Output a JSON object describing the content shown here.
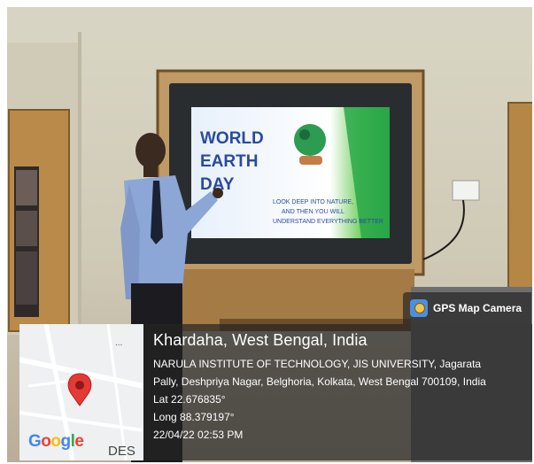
{
  "screen": {
    "title": "WORLD EARTH DAY",
    "tagline_1": "LOOK DEEP INTO NATURE,",
    "tagline_2": "AND THEN YOU WILL",
    "tagline_3": "UNDERSTAND EVERYTHING BETTER"
  },
  "badge": {
    "app_name": "GPS Map Camera",
    "icon": "gps-map-camera-icon"
  },
  "location": {
    "title": "Khardaha, West Bengal, India",
    "address_line_1": "NARULA INSTITUTE OF TECHNOLOGY, JIS UNIVERSITY, Jagarata",
    "address_line_2": "Pally, Deshpriya Nagar, Belghoria, Kolkata, West Bengal 700109, India",
    "lat": "Lat 22.676835°",
    "long": "Long 88.379197°",
    "datetime": "22/04/22 02:53 PM"
  },
  "map": {
    "brand": [
      "G",
      "o",
      "o",
      "g",
      "l",
      "e"
    ],
    "partial_label": "DES",
    "marker_color": "#e53935",
    "dots": "..."
  }
}
